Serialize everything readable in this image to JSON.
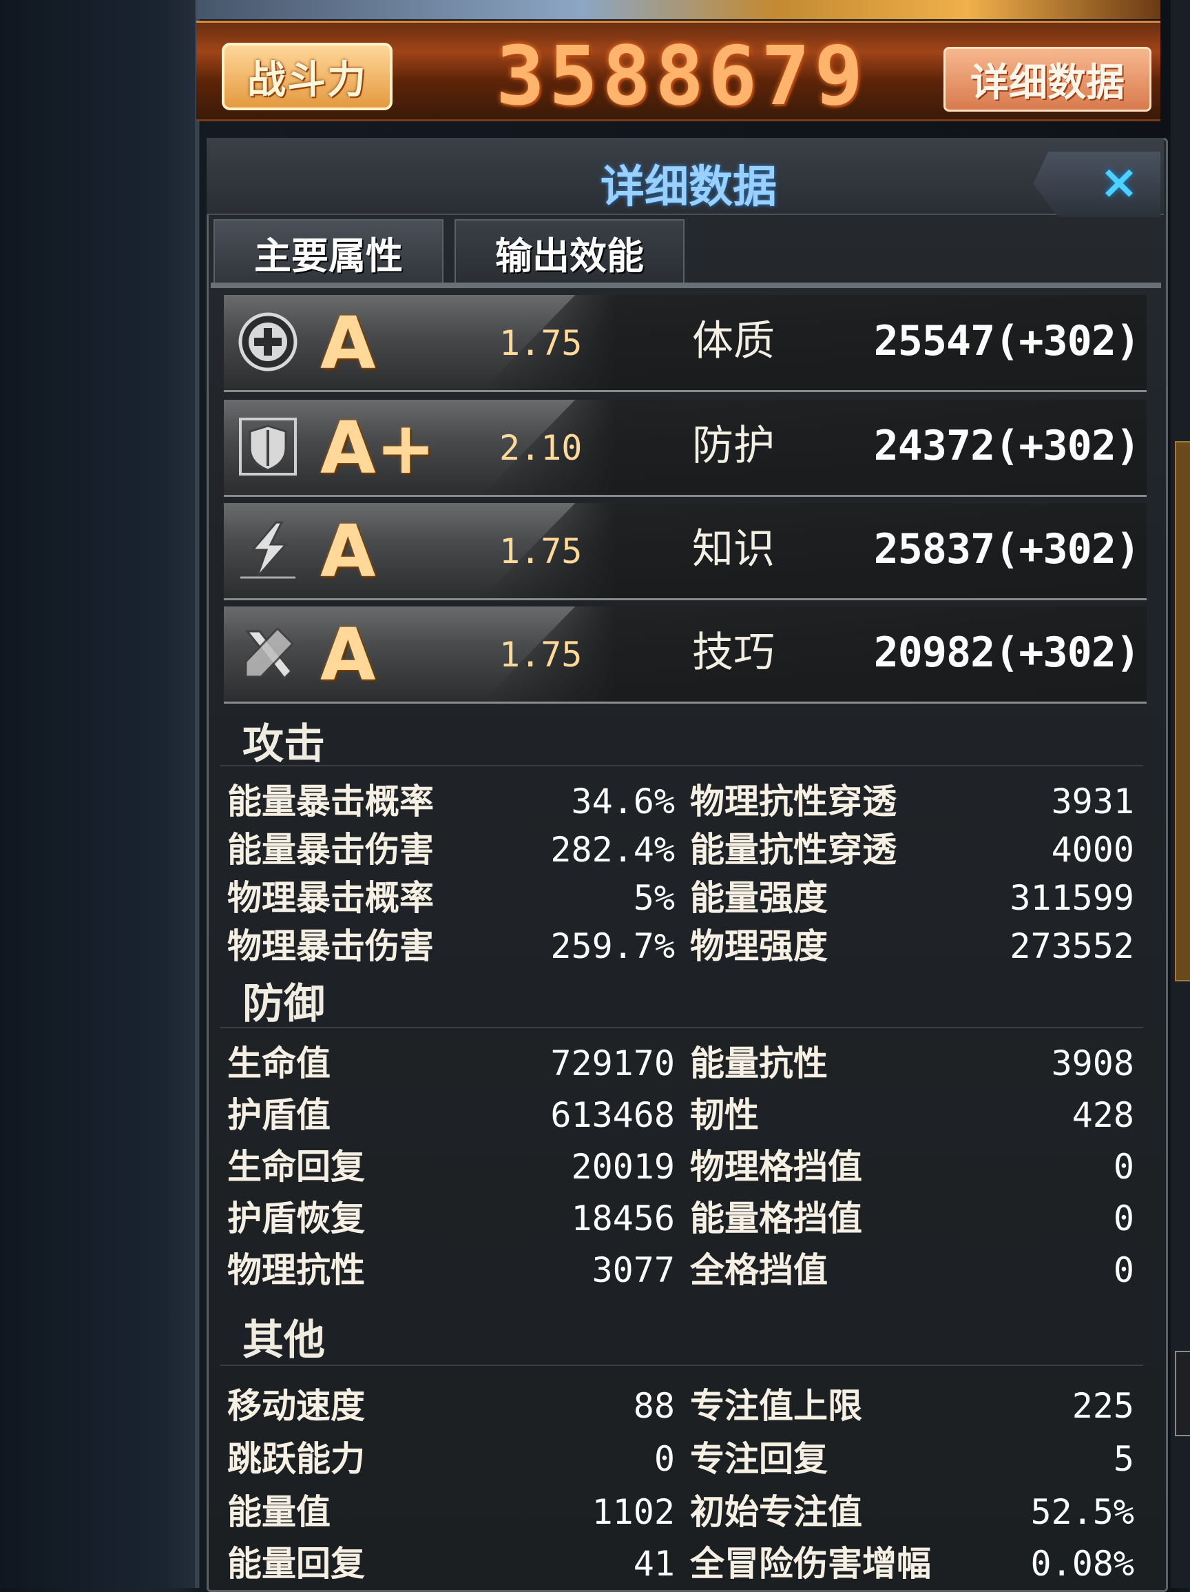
{
  "power": {
    "label": "战斗力",
    "value": "3588679",
    "detail_button": "详细数据"
  },
  "panel": {
    "title": "详细数据",
    "close": "×"
  },
  "tabs": [
    {
      "label": "主要属性"
    },
    {
      "label": "输出效能"
    }
  ],
  "attributes": [
    {
      "icon": "health-cross-icon",
      "grade": "A",
      "coef": "1.75",
      "name": "体质",
      "value": "25547(+302)"
    },
    {
      "icon": "shield-icon",
      "grade": "A+",
      "coef": "2.10",
      "name": "防护",
      "value": "24372(+302)"
    },
    {
      "icon": "lightning-icon",
      "grade": "A",
      "coef": "1.75",
      "name": "知识",
      "value": "25837(+302)"
    },
    {
      "icon": "tool-icon",
      "grade": "A",
      "coef": "1.75",
      "name": "技巧",
      "value": "20982(+302)"
    }
  ],
  "sections": {
    "attack": {
      "title": "攻击",
      "left": [
        {
          "label": "能量暴击概率",
          "value": "34.6%"
        },
        {
          "label": "能量暴击伤害",
          "value": "282.4%"
        },
        {
          "label": "物理暴击概率",
          "value": "5%"
        },
        {
          "label": "物理暴击伤害",
          "value": "259.7%"
        }
      ],
      "right": [
        {
          "label": "物理抗性穿透",
          "value": "3931"
        },
        {
          "label": "能量抗性穿透",
          "value": "4000"
        },
        {
          "label": "能量强度",
          "value": "311599"
        },
        {
          "label": "物理强度",
          "value": "273552"
        }
      ]
    },
    "defense": {
      "title": "防御",
      "left": [
        {
          "label": "生命值",
          "value": "729170"
        },
        {
          "label": "护盾值",
          "value": "613468"
        },
        {
          "label": "生命回复",
          "value": "20019"
        },
        {
          "label": "护盾恢复",
          "value": "18456"
        },
        {
          "label": "物理抗性",
          "value": "3077"
        }
      ],
      "right": [
        {
          "label": "能量抗性",
          "value": "3908"
        },
        {
          "label": "韧性",
          "value": "428"
        },
        {
          "label": "物理格挡值",
          "value": "0"
        },
        {
          "label": "能量格挡值",
          "value": "0"
        },
        {
          "label": "全格挡值",
          "value": "0"
        }
      ]
    },
    "other": {
      "title": "其他",
      "left": [
        {
          "label": "移动速度",
          "value": "88"
        },
        {
          "label": "跳跃能力",
          "value": "0"
        },
        {
          "label": "能量值",
          "value": "1102"
        },
        {
          "label": "能量回复",
          "value": "41"
        }
      ],
      "right": [
        {
          "label": "专注值上限",
          "value": "225"
        },
        {
          "label": "专注回复",
          "value": "5"
        },
        {
          "label": "初始专注值",
          "value": "52.5%"
        },
        {
          "label": "全冒险伤害增幅",
          "value": "0.08%"
        }
      ]
    }
  }
}
